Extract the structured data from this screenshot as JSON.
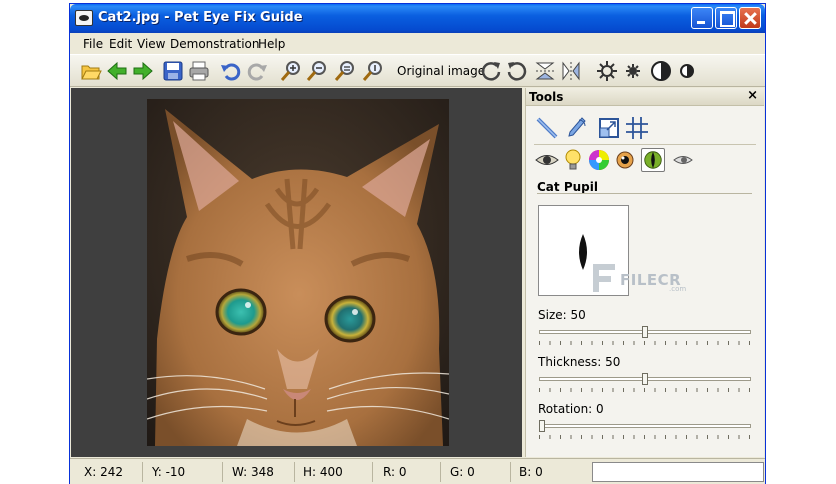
{
  "window": {
    "title": "Cat2.jpg - Pet Eye Fix Guide"
  },
  "menu": [
    "File",
    "Edit",
    "View",
    "Demonstration",
    "Help"
  ],
  "toolbar": {
    "original_image_label": "Original image",
    "icons": [
      "open-icon",
      "back-arrow-icon",
      "forward-arrow-icon",
      "save-icon",
      "print-icon",
      "undo-icon",
      "redo-icon",
      "zoom-in-icon",
      "zoom-out-icon",
      "zoom-fit-icon",
      "zoom-actual-icon",
      "rotate-cw-icon",
      "rotate-ccw-icon",
      "flip-vertical-icon",
      "flip-horizontal-icon",
      "brightness-up-icon",
      "brightness-down-icon",
      "contrast-up-icon",
      "contrast-down-icon"
    ]
  },
  "panel": {
    "title": "Tools",
    "close": "×",
    "row1_icons": [
      "pencil-icon",
      "brush-icon",
      "resize-icon",
      "crop-grid-icon"
    ],
    "row2_icons": [
      "eye-icon",
      "bulb-icon",
      "color-wheel-icon",
      "pupil-round-icon",
      "cat-pupil-icon",
      "pet-eye-icon"
    ],
    "section_title": "Cat Pupil",
    "sliders": [
      {
        "label": "Size: 50",
        "value": 50,
        "max": 100
      },
      {
        "label": "Thickness: 50",
        "value": 50,
        "max": 100
      },
      {
        "label": "Rotation: 0",
        "value": 0,
        "max": 100
      }
    ]
  },
  "status": {
    "x": "X: 242",
    "y": "Y: -10",
    "w": "W: 348",
    "h": "H: 400",
    "r": "R: 0",
    "g": "G: 0",
    "b": "B: 0",
    "extra": ""
  },
  "watermark": {
    "text": "FILECR",
    "sub": ".com"
  }
}
